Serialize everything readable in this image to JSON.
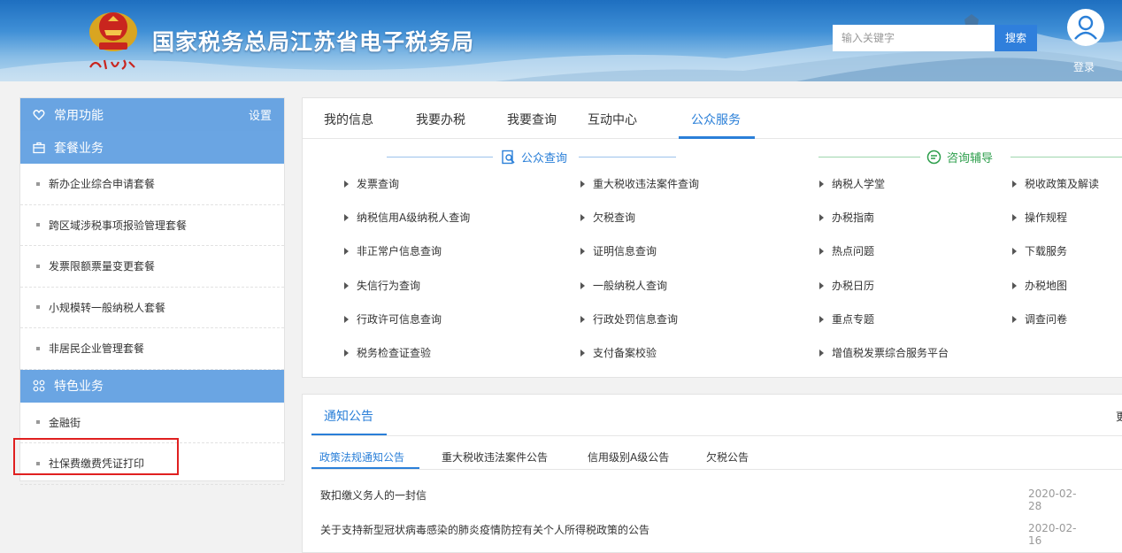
{
  "header": {
    "title": "国家税务总局江苏省电子税务局",
    "search_placeholder": "输入关键字",
    "search_button": "搜索",
    "login": "登录"
  },
  "sidebar": {
    "common_label": "常用功能",
    "settings_label": "设置",
    "package_label": "套餐业务",
    "package_items": [
      "新办企业综合申请套餐",
      "跨区域涉税事项报验管理套餐",
      "发票限额票量变更套餐",
      "小规模转一般纳税人套餐",
      "非居民企业管理套餐"
    ],
    "special_label": "特色业务",
    "special_items": [
      "金融街",
      "社保费缴费凭证打印"
    ]
  },
  "main_tabs": [
    "我的信息",
    "我要办税",
    "我要查询",
    "互动中心",
    "公众服务"
  ],
  "public_query": {
    "title": "公众查询",
    "col1": [
      "发票查询",
      "纳税信用A级纳税人查询",
      "非正常户信息查询",
      "失信行为查询",
      "行政许可信息查询",
      "税务检查证查验"
    ],
    "col2": [
      "重大税收违法案件查询",
      "欠税查询",
      "证明信息查询",
      "一般纳税人查询",
      "行政处罚信息查询",
      "支付备案校验"
    ]
  },
  "consult": {
    "title": "咨询辅导",
    "col1": [
      "纳税人学堂",
      "办税指南",
      "热点问题",
      "办税日历",
      "重点专题",
      "增值税发票综合服务平台"
    ],
    "col2": [
      "税收政策及解读",
      "操作规程",
      "下载服务",
      "办税地图",
      "调查问卷"
    ]
  },
  "notice": {
    "title": "通知公告",
    "more": "更",
    "subtabs": [
      "政策法规通知公告",
      "重大税收违法案件公告",
      "信用级别A级公告",
      "欠税公告"
    ],
    "rows": [
      {
        "title": "致扣缴义务人的一封信",
        "date": "2020-02-28"
      },
      {
        "title": "关于支持新型冠状病毒感染的肺炎疫情防控有关个人所得税政策的公告",
        "date": "2020-02-16"
      }
    ]
  },
  "colors": {
    "accent": "#2a7fd8",
    "sidebar_head": "#6aa5e3",
    "consult_green": "#2c9e4b",
    "highlight_red": "#e02020"
  }
}
